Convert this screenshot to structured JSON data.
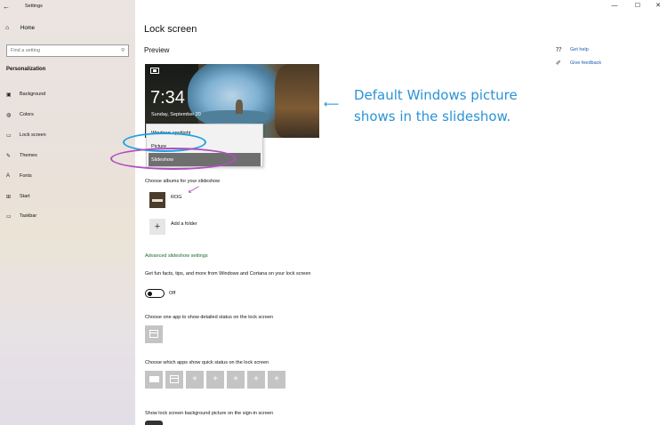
{
  "window": {
    "title": "Settings",
    "back_glyph": "←",
    "minimize_glyph": "—",
    "maximize_glyph": "☐",
    "close_glyph": "✕"
  },
  "sidebar": {
    "home_label": "Home",
    "search_placeholder": "Find a setting",
    "section": "Personalization",
    "items": [
      {
        "label": "Background",
        "icon": "image-icon",
        "glyph": "▣"
      },
      {
        "label": "Colors",
        "icon": "palette-icon",
        "glyph": "◍"
      },
      {
        "label": "Lock screen",
        "icon": "lock-screen-icon",
        "glyph": "▭"
      },
      {
        "label": "Themes",
        "icon": "brush-icon",
        "glyph": "✎"
      },
      {
        "label": "Fonts",
        "icon": "font-icon",
        "glyph": "A"
      },
      {
        "label": "Start",
        "icon": "start-icon",
        "glyph": "⊞"
      },
      {
        "label": "Taskbar",
        "icon": "taskbar-icon",
        "glyph": "▭"
      }
    ]
  },
  "main": {
    "title": "Lock screen",
    "preview_label": "Preview",
    "preview_time": "7:34",
    "preview_date": "Sunday, September 20",
    "dropdown_options": [
      "Windows spotlight",
      "Picture",
      "Slideshow"
    ],
    "dropdown_selected": "Slideshow",
    "albums_label": "Choose albums for your slideshow",
    "album_name": "ROG",
    "add_folder_label": "Add a folder",
    "advanced_link": "Advanced slideshow settings",
    "fun_facts_desc": "Get fun facts, tips, and more from Windows and Cortana on your lock screen",
    "toggle_state": "Off",
    "detailed_status_label": "Choose one app to show detailed status on the lock screen",
    "quick_status_label": "Choose which apps show quick status on the lock screen",
    "signin_label": "Show lock screen background picture on the sign-in screen",
    "plus_glyph": "+"
  },
  "help": {
    "get_help": "Get help",
    "feedback": "Give feedback"
  },
  "annotation": {
    "text": "Default Windows picture shows in the slideshow.",
    "arrow": "⟵"
  },
  "colors": {
    "annotation_blue": "#2a93d8",
    "ring_blue": "#1aa1e1",
    "ring_purple": "#b14ec0",
    "link_green": "#1a6b2e",
    "link_blue": "#1a5fb0"
  }
}
